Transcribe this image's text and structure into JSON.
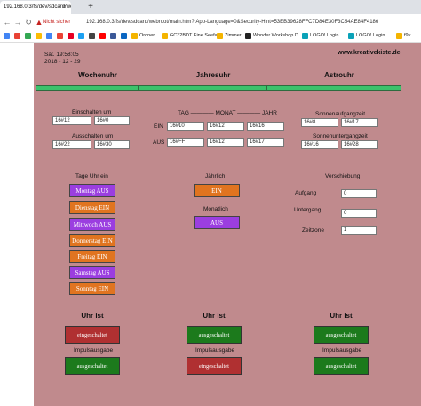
{
  "browser": {
    "tab_title": "192.168.0.3/fs/dev/sdcard/webr...",
    "tab_close": "×",
    "new_tab": "+",
    "security_warning": "Nicht sicher",
    "url": "192.168.0.3/fs/dev/sdcard/webroot/main.htm?!App-Language=0&Security-Hint=53EB39628FFC7D84E30F3C54AE84F4186",
    "bookmarks": [
      "Ordner",
      "GC32BDT Eine Seefahr...",
      "Zimmer",
      "Wonder Workshop D...",
      "LOGO! Login",
      "LOGO! Login",
      "f9v"
    ]
  },
  "header": {
    "datetime_line1": "Sat. 19:58:05",
    "datetime_line2": "2018 - 12 - 29",
    "website": "www.kreativekiste.de"
  },
  "sections": {
    "wochenuhr": "Wochenuhr",
    "jahresuhr": "Jahresuhr",
    "astrouhr": "Astrouhr"
  },
  "wochenuhr": {
    "on_label": "Einschalten um",
    "on_hour": "16#12",
    "on_min": "16#0",
    "off_label": "Ausschalten um",
    "off_hour": "16#22",
    "off_min": "16#30",
    "days_title": "Tage Uhr ein",
    "days": [
      "Montag AUS",
      "Dienstag EIN",
      "Mittwoch AUS",
      "Donnerstag EIN",
      "Freitag EIN",
      "Samstag AUS",
      "Sonntag EIN"
    ]
  },
  "jahresuhr": {
    "header": "TAG ———— MONAT ———— JAHR",
    "ein_label": "EIN",
    "aus_label": "AUS",
    "ein_tag": "16#10",
    "ein_monat": "16#12",
    "ein_jahr": "16#16",
    "aus_tag": "16#FF",
    "aus_monat": "16#12",
    "aus_jahr": "16#17",
    "yearly_label": "Jährlich",
    "yearly_button": "EIN",
    "monthly_label": "Monatlich",
    "monthly_button": "AUS"
  },
  "astrouhr": {
    "sunrise_label": "Sonnenaufgangzeit",
    "sunrise_hour": "16#8",
    "sunrise_min": "16#17",
    "sunset_label": "Sonnenuntergangzeit",
    "sunset_hour": "16#16",
    "sunset_min": "16#28",
    "shift_title": "Verschiebung",
    "aufgang_label": "Aufgang",
    "aufgang_value": "0",
    "untergang_label": "Untergang",
    "untergang_value": "0",
    "zeitzone_label": "Zeitzone",
    "zeitzone_value": "1"
  },
  "status": {
    "uhr_ist": "Uhr ist",
    "impuls": "Impulsausgabe",
    "col1_uhr": "eingeschaltet",
    "col1_impuls": "ausgeschaltet",
    "col2_uhr": "ausgeschaltet",
    "col2_impuls": "eingeschaltet",
    "col3_uhr": "ausgeschaltet",
    "col3_impuls": "ausgeschaltet"
  },
  "colors": {
    "panel": "#c08a8d",
    "green_bar": "#3ac26b",
    "purple": "#9b3ee0",
    "orange": "#e07420",
    "red": "#b03031",
    "green": "#1c7a1c"
  }
}
